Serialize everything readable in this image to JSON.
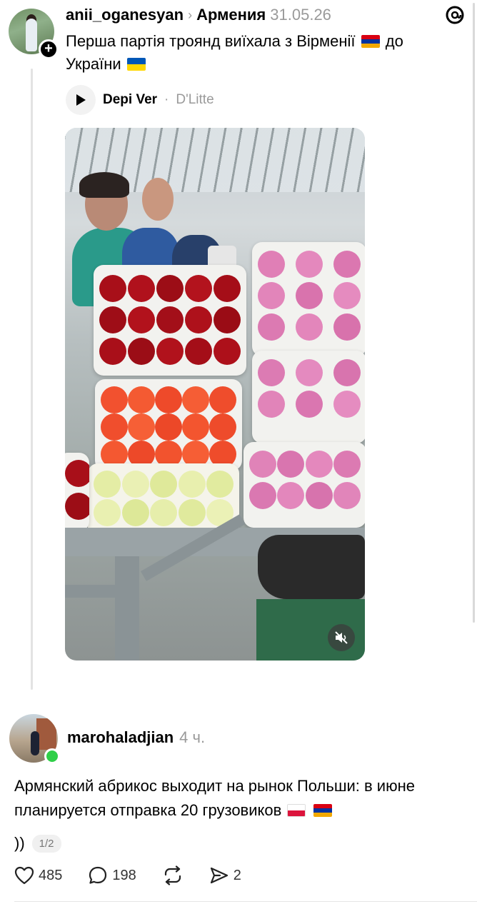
{
  "post1": {
    "username": "anii_oganesyan",
    "location": "Армения",
    "timestamp": "31.05.26",
    "text_part1": "Перша партія троянд виїхала з Вірменії",
    "text_part2": "до",
    "text_part3": "України",
    "audio": {
      "artist": "Depi Ver",
      "separator": "·",
      "song": "D'Litte"
    }
  },
  "post2": {
    "username": "marohaladjian",
    "timestamp": "4 ч.",
    "text": "Армянский абрикос выходит на рынок Польши: в июне планируется отправка 20 грузовиков",
    "reply_text": "))",
    "pager": "1/2",
    "actions": {
      "likes": "485",
      "comments": "198",
      "shares": "2"
    }
  },
  "colors": {
    "thread_line": "#e3e3e3",
    "muted_text": "#9a9a9a",
    "online": "#2fcf48"
  },
  "icons": [
    "threads-logo-icon",
    "plus-icon",
    "play-icon",
    "mute-icon",
    "heart-icon",
    "comment-icon",
    "repost-icon",
    "share-icon",
    "chevron-right-icon"
  ]
}
